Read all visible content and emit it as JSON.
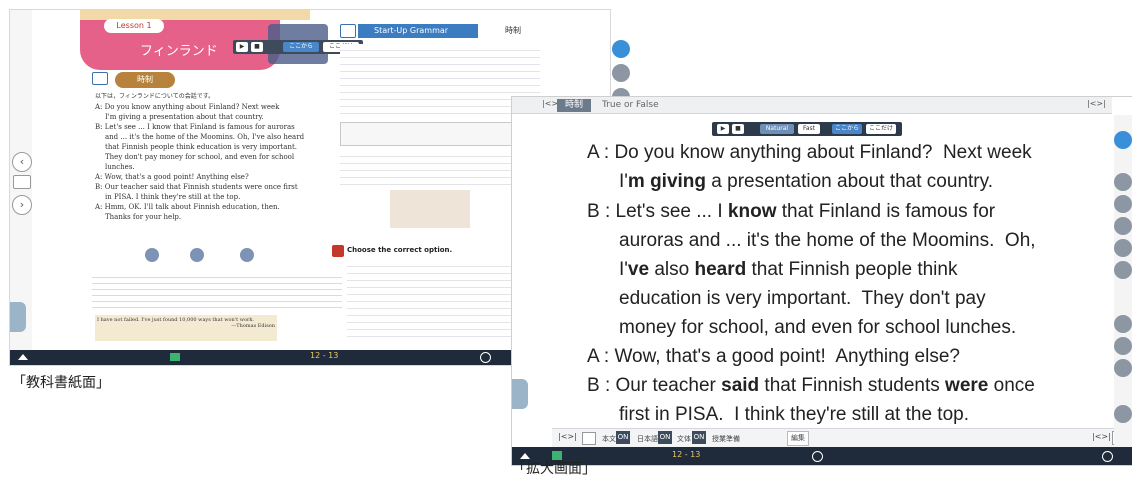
{
  "textbook": {
    "caption": "「教科書紙面」",
    "lesson_tag": "Lesson 1",
    "lesson_subtitle": "フィンランド",
    "grammar_tab": "Start-Up Grammar",
    "grammar_tab2": "時制",
    "section_pill": "時制",
    "controls": {
      "kokokara": "ここから",
      "kokodake": "ここだけ"
    },
    "dialogue": [
      "以下は，フィンランドについての会話です。",
      "A: Do you know anything about Finland? Next week",
      "I'm giving a presentation about that country.",
      "B: Let's see ... I know that Finland is famous for auroras",
      "and ... it's the home of the Moomins. Oh, I've also heard",
      "that Finnish people think education is very important.",
      "They don't pay money for school, and even for school",
      "lunches.",
      "A: Wow, that's a good point! Anything else?",
      "B: Our teacher said that Finnish students were once first",
      "in PISA. I think they're still at the top.",
      "A: Hmm, OK. I'll talk about Finnish education, then.",
      "Thanks for your help."
    ],
    "exercise_title": "Choose the correct option.",
    "quote": "I have not failed. I've just found 10,000 ways that won't work.",
    "quote_author": "—Thomas Edison",
    "page_label": "12 - 13"
  },
  "enlarged": {
    "caption": "「拡大画面」",
    "tab_active": "時制",
    "tab_other": "True or False",
    "controls": {
      "natural": "Natural",
      "fast": "Fast",
      "kokokara": "ここから",
      "kokodake": "ここだけ"
    },
    "subbar": {
      "honbun": "本文",
      "honbun_on": "ON",
      "nihongo": "日本語",
      "nihongo_on": "ON",
      "bunkotai": "文体",
      "bunkotai_on": "ON",
      "jugyo": "授業準備",
      "hensyu": "編集"
    },
    "page_label": "12 - 13"
  }
}
